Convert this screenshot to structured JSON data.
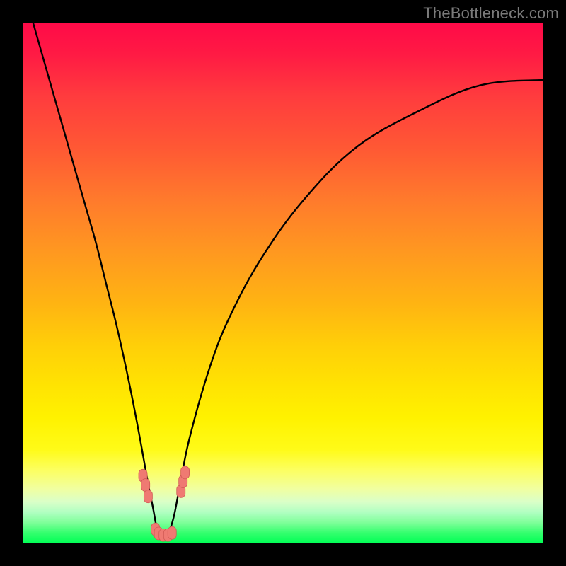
{
  "watermark": "TheBottleneck.com",
  "colors": {
    "frame": "#000000",
    "curve": "#000000",
    "marker_fill": "#ef7a72",
    "marker_stroke": "#d05a54",
    "gradient_top": "#ff0a48",
    "gradient_bottom": "#00ff55"
  },
  "chart_data": {
    "type": "line",
    "title": "",
    "xlabel": "",
    "ylabel": "",
    "xlim": [
      0,
      100
    ],
    "ylim": [
      0,
      100
    ],
    "grid": false,
    "legend": false,
    "curve_description": "V-shaped bottleneck curve: steep descent from upper-left to a minimum near x≈26, then rising concave toward upper-right",
    "series": [
      {
        "name": "bottleneck-curve",
        "x": [
          2,
          4,
          6,
          8,
          10,
          12,
          14,
          16,
          18,
          20,
          22,
          24,
          25,
          26,
          27,
          28,
          29,
          30,
          32,
          36,
          40,
          46,
          54,
          64,
          76,
          88,
          100
        ],
        "y": [
          100,
          93,
          86,
          79,
          72,
          65,
          58,
          50,
          42,
          33,
          23,
          12,
          7,
          2,
          1,
          2,
          5,
          10,
          20,
          34,
          44,
          55,
          66,
          76,
          83,
          88,
          89
        ],
        "note": "y is percentage height from bottom (0 = bottom green band, 100 = top red band); estimated from pixel positions"
      }
    ],
    "markers": {
      "name": "highlighted-points",
      "shape": "rounded-pill",
      "color": "#ef7a72",
      "points": [
        {
          "x": 23.1,
          "y": 13.0
        },
        {
          "x": 23.6,
          "y": 11.2
        },
        {
          "x": 24.1,
          "y": 9.0
        },
        {
          "x": 25.5,
          "y": 2.7
        },
        {
          "x": 26.1,
          "y": 1.9
        },
        {
          "x": 27.0,
          "y": 1.6
        },
        {
          "x": 27.9,
          "y": 1.6
        },
        {
          "x": 28.7,
          "y": 2.0
        },
        {
          "x": 30.4,
          "y": 10.0
        },
        {
          "x": 30.8,
          "y": 11.9
        },
        {
          "x": 31.2,
          "y": 13.6
        }
      ],
      "note": "clusters of salmon pill-shaped markers near the curve minimum, on both sides of the V"
    }
  }
}
